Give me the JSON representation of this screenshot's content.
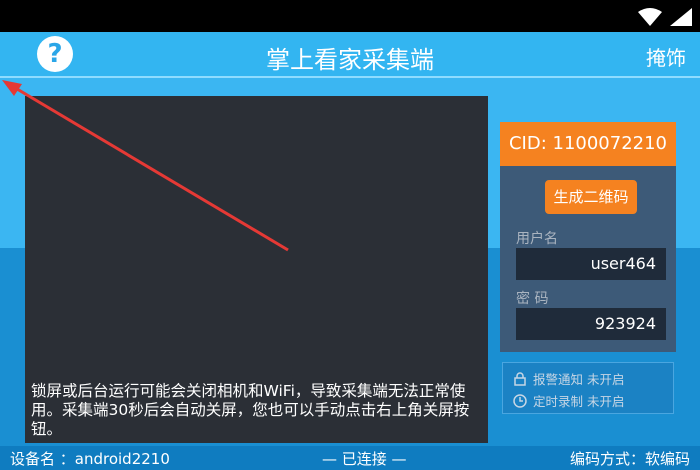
{
  "header": {
    "title": "掌上看家采集端",
    "help_label": "?",
    "hide_label": "掩饰"
  },
  "preview": {
    "message": "锁屏或后台运行可能会关闭相机和WiFi，导致采集端无法正常使用。采集端30秒后会自动关屏，您也可以手动点击右上角关屏按钮。"
  },
  "panel": {
    "cid": "CID: 1100072210",
    "qr_button": "生成二维码",
    "username_label": "用户名",
    "username_value": "user464",
    "password_label": "密 码",
    "password_value": "923924"
  },
  "notify": {
    "alarm": "报警通知 未开启",
    "schedule": "定时录制 未开启"
  },
  "footer": {
    "device": "设备名 ：android2210",
    "status": "— 已连接 —",
    "encoding": "编码方式：软编码"
  },
  "colors": {
    "accent": "#f58220",
    "header": "#33b5f1",
    "panel": "#3d5a78",
    "annotation_arrow": "#e53935"
  }
}
